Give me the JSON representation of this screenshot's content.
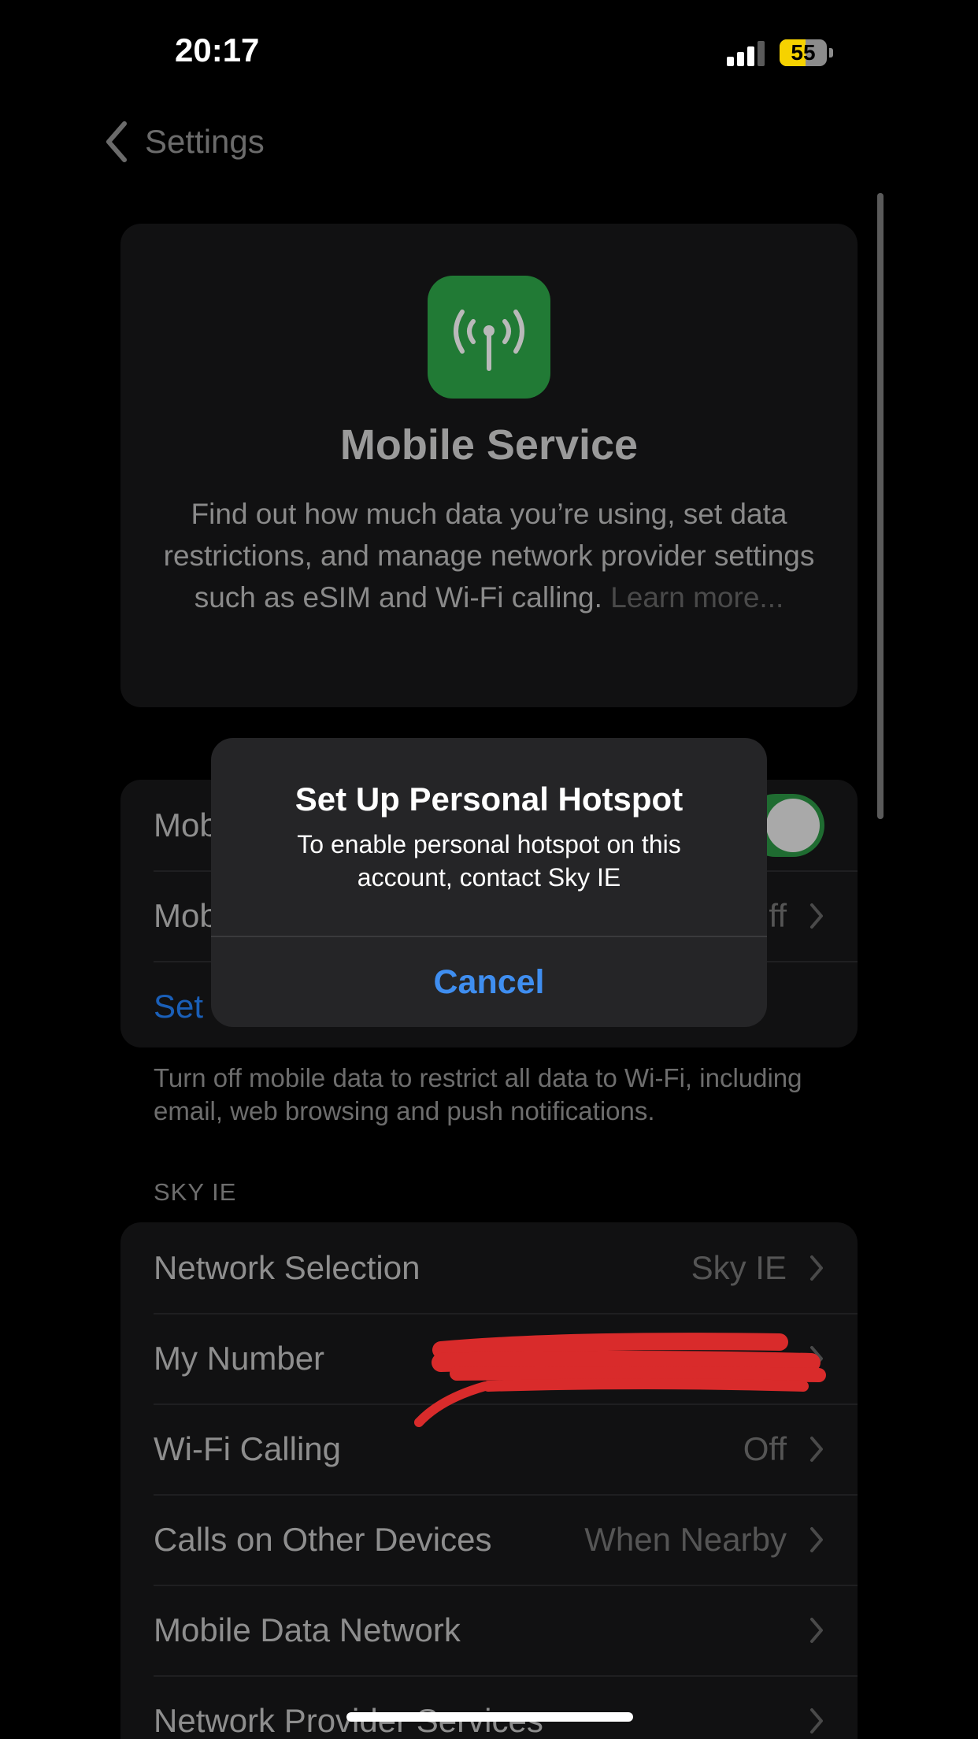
{
  "status_bar": {
    "time": "20:17",
    "battery_percent": "55",
    "battery_level": 0.55,
    "icons": [
      "signal-icon",
      "battery-icon"
    ]
  },
  "nav": {
    "back_label": "Settings",
    "back_icon": "chevron-left-icon"
  },
  "header": {
    "icon": "antenna-icon",
    "icon_color": "#217a35",
    "title": "Mobile Service",
    "description": "Find out how much data you’re using, set data restrictions, and manage network provider settings such as eSIM and Wi-Fi calling.",
    "learn_more": "Learn more..."
  },
  "mobile_group": {
    "rows": [
      {
        "label": "Mob",
        "toggle_on": true
      },
      {
        "label": "Mob",
        "value": "ff"
      },
      {
        "label": "Set"
      }
    ],
    "footnote": "Turn off mobile data to restrict all data to Wi-Fi, including email, web browsing and push notifications."
  },
  "carrier_section": {
    "header": "SKY IE",
    "rows": [
      {
        "label": "Network Selection",
        "value": "Sky IE"
      },
      {
        "label": "My Number",
        "value": ""
      },
      {
        "label": "Wi-Fi Calling",
        "value": "Off"
      },
      {
        "label": "Calls on Other Devices",
        "value": "When Nearby"
      },
      {
        "label": "Mobile Data Network",
        "value": ""
      },
      {
        "label": "Network Provider Services",
        "value": ""
      }
    ]
  },
  "alert": {
    "title": "Set Up Personal Hotspot",
    "message": "To enable personal hotspot on this account, contact Sky IE",
    "button": "Cancel"
  },
  "colors": {
    "accent_blue": "#3f8ef0",
    "redaction_red": "#d92b2b",
    "toggle_green": "#1f6c31"
  }
}
